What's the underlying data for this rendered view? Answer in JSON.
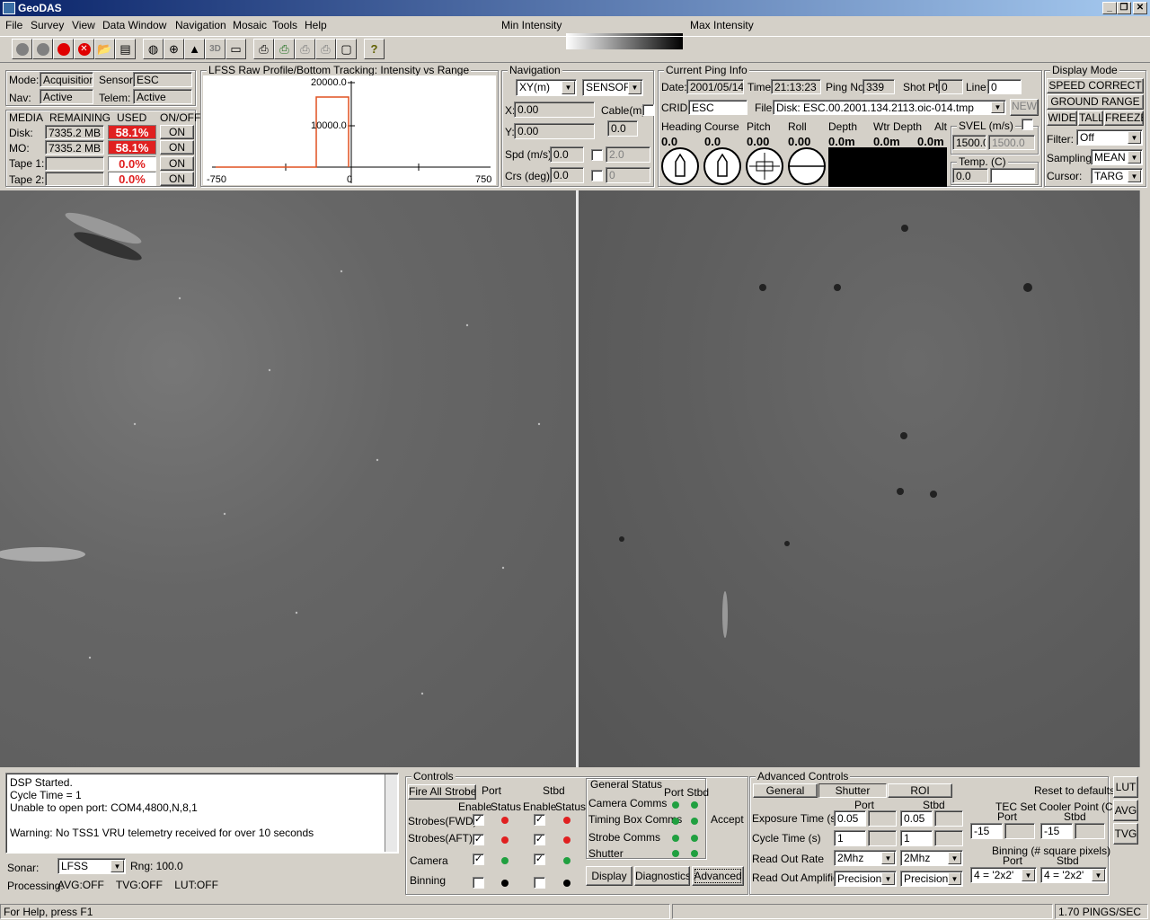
{
  "app": {
    "title": "GeoDAS"
  },
  "menu": [
    "File",
    "Survey",
    "View",
    "Data Window",
    "Navigation",
    "Mosaic",
    "Tools",
    "Help"
  ],
  "intensity": {
    "min_label": "Min Intensity",
    "max_label": "Max Intensity"
  },
  "toolbar": {
    "icons": [
      "record-grey-icon",
      "record-grey-icon",
      "record-red-icon",
      "stop-icon",
      "open-icon",
      "print-preview-icon",
      "globe-icon",
      "crosshair-icon",
      "terrain-icon",
      "3d-icon",
      "window-icon",
      "print-icon",
      "print-green-icon",
      "print-grey-icon",
      "print-grey2-icon",
      "frame-icon",
      "help-icon"
    ],
    "label_3d": "3D",
    "help": "?"
  },
  "status_panel": {
    "mode_label": "Mode:",
    "mode": "Acquisition",
    "sensor_label": "Sensor:",
    "sensor": "ESC",
    "nav_label": "Nav:",
    "nav": "Active",
    "telem_label": "Telem:",
    "telem": "Active",
    "media_headers": [
      "MEDIA",
      "REMAINING",
      "USED",
      "ON/OFF"
    ],
    "media": [
      {
        "name": "Disk:",
        "remaining": "7335.2 MB",
        "used": "58.1%",
        "on": "ON"
      },
      {
        "name": "MO:",
        "remaining": "7335.2 MB",
        "used": "58.1%",
        "on": "ON"
      },
      {
        "name": "Tape 1:",
        "remaining": "",
        "used": "0.0%",
        "on": "ON"
      },
      {
        "name": "Tape 2:",
        "remaining": "",
        "used": "0.0%",
        "on": "ON"
      }
    ]
  },
  "profile": {
    "title": "LFSS Raw Profile/Bottom Tracking: Intensity vs Range",
    "y_top": "20000.0",
    "y_mid": "10000.0",
    "x_left": "-750",
    "x_mid": "0",
    "x_right": "750"
  },
  "navigation": {
    "title": "Navigation",
    "coord": "XY(m)",
    "source": "SENSOR",
    "x_label": "X:",
    "x": "0.00",
    "y_label": "Y:",
    "y": "0.00",
    "cable_label": "Cable(m):",
    "cable": "0.0",
    "spd_label": "Spd (m/s):",
    "spd": "0.0",
    "spd2": "2.0",
    "crs_label": "Crs (deg):",
    "crs": "0.0",
    "crs2": "0"
  },
  "ping": {
    "title": "Current Ping Info",
    "date_label": "Date:",
    "date": "2001/05/14",
    "time_label": "Time:",
    "time": "21:13:23",
    "ping_label": "Ping No:",
    "ping": "339",
    "shot_label": "Shot Pt:",
    "shot": "0",
    "line_label": "Line:",
    "line": "0",
    "crid_label": "CRID:",
    "crid": "ESC",
    "file_label": "File:",
    "file": "Disk: ESC.00.2001.134.2113.oic-014.tmp",
    "new": "NEW",
    "headers": [
      "Heading",
      "Course",
      "Pitch",
      "Roll",
      "Depth",
      "Wtr Depth",
      "Alt"
    ],
    "values": [
      "0.0",
      "0.0",
      "0.00",
      "0.00",
      "0.0m",
      "0.0m",
      "0.0m"
    ],
    "svel_label": "SVEL (m/s)",
    "svel": "1500.0",
    "svel2": "1500.0",
    "temp_label": "Temp. (C)",
    "temp": "0.0"
  },
  "display_mode": {
    "title": "Display Mode",
    "speed": "SPEED CORRECT",
    "ground": "GROUND RANGE",
    "wide": "WIDE",
    "tall": "TALL",
    "freeze": "FREEZE",
    "filter_label": "Filter:",
    "filter": "Off",
    "sampling_label": "Sampling:",
    "sampling": "MEAN",
    "cursor_label": "Cursor:",
    "cursor": "TARG"
  },
  "log": {
    "lines": [
      "DSP Started.",
      "Cycle Time = 1",
      "Unable to open port: COM4,4800,N,8,1",
      "",
      "Warning: No TSS1 VRU telemetry received for over 10 seconds"
    ],
    "sonar_label": "Sonar:",
    "sonar": "LFSS",
    "rng": "Rng: 100.0",
    "processing_label": "Processing:",
    "processing": "AVG:OFF    TVG:OFF    LUT:OFF"
  },
  "controls": {
    "title": "Controls",
    "fire": "Fire All Strobes",
    "port": "Port",
    "stbd": "Stbd",
    "enable": "Enable",
    "status": "Status",
    "rows": [
      {
        "name": "Strobes(FWD)",
        "pe": true,
        "ps": "red",
        "se": true,
        "ss": "red"
      },
      {
        "name": "Strobes(AFT)",
        "pe": true,
        "ps": "red",
        "se": true,
        "ss": "red"
      },
      {
        "name": "Camera",
        "pe": true,
        "ps": "green",
        "se": true,
        "ss": "green"
      },
      {
        "name": "Binning",
        "pe": false,
        "ps": "black",
        "se": false,
        "ss": "black"
      }
    ],
    "general_status": "General Status",
    "gs_port_stbd": "Port Stbd",
    "gs_items": [
      "Camera Comms",
      "Timing Box Comms",
      "Strobe Comms",
      "Shutter"
    ],
    "accept": "Accept",
    "display": "Display",
    "diagnostics": "Diagnostics",
    "advanced": "Advanced",
    "check": "✓"
  },
  "advanced": {
    "title": "Advanced Controls",
    "tabs": [
      "General",
      "Shutter",
      "ROI"
    ],
    "reset": "Reset to defaults",
    "port": "Port",
    "stbd": "Stbd",
    "exposure_label": "Exposure Time (s)",
    "exp_port": "0.05",
    "exp_stbd": "0.05",
    "cycle_label": "Cycle Time (s)",
    "cyc_port": "1",
    "cyc_stbd": "1",
    "rate_label": "Read Out Rate",
    "rate_port": "2Mhz",
    "rate_stbd": "2Mhz",
    "amp_label": "Read Out Amplifier",
    "amp_port": "Precision",
    "amp_stbd": "Precision",
    "tec_label": "TEC Set Cooler Point (C)",
    "tec_port": "-15",
    "tec_stbd": "-15",
    "bin_label": "Binning (# square pixels)",
    "bin_port": "4 = '2x2'",
    "bin_stbd": "4 = '2x2'"
  },
  "side_buttons": [
    "LUT",
    "AVG",
    "TVG"
  ],
  "status": {
    "help": "For Help, press F1",
    "rate": "1.70 PINGS/SEC"
  }
}
